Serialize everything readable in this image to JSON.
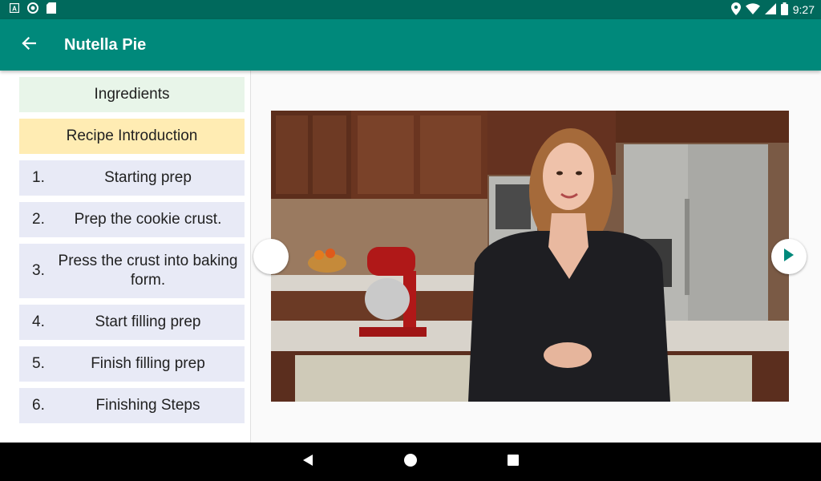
{
  "status_bar": {
    "time": "9:27",
    "left_icons": [
      "notification-a-icon",
      "sync-circle-icon",
      "sd-card-icon"
    ],
    "right_icons": [
      "location-icon",
      "wifi-icon",
      "cell-signal-icon",
      "battery-icon"
    ]
  },
  "app_bar": {
    "back_icon": "arrow-back-icon",
    "title": "Nutella Pie",
    "color": "#00897b",
    "status_color": "#00695c"
  },
  "sidebar": {
    "ingredients": {
      "label": "Ingredients",
      "color": "#e8f5e9"
    },
    "introduction": {
      "label": "Recipe Introduction",
      "color": "#ffecb3"
    },
    "steps": [
      {
        "number": "1.",
        "label": "Starting prep"
      },
      {
        "number": "2.",
        "label": "Prep the cookie crust."
      },
      {
        "number": "3.",
        "label": "Press the crust into baking form."
      },
      {
        "number": "4.",
        "label": "Start filling prep"
      },
      {
        "number": "5.",
        "label": "Finish filling prep"
      },
      {
        "number": "6.",
        "label": "Finishing Steps"
      }
    ],
    "step_color": "#e8eaf6"
  },
  "player": {
    "prev_icon": "previous-step-icon",
    "next_icon": "play-next-icon",
    "accent": "#00897b"
  },
  "navigation": {
    "icons": [
      "back-triangle-icon",
      "home-circle-icon",
      "recents-square-icon"
    ]
  }
}
